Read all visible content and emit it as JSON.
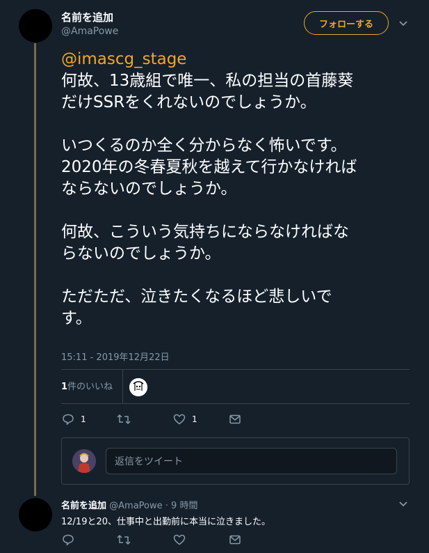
{
  "main_tweet": {
    "author_name": "名前を追加",
    "author_handle": "@AmaPowe",
    "follow_label": "フォローする",
    "mention": "@imascg_stage",
    "lines": [
      "何故、13歳組で唯一、私の担当の首藤葵",
      "だけSSRをくれないのでしょうか。",
      "",
      "いつくるのか全く分からなく怖いです。",
      "2020年の冬春夏秋を越えて行かなければ",
      "ならないのでしょうか。",
      "",
      "何故、こういう気持ちにならなければな",
      "らないのでしょうか。",
      "",
      "ただただ、泣きたくなるほど悲しいで",
      "す。"
    ],
    "timestamp": "15:11 - 2019年12月22日",
    "likes_count": "1",
    "likes_label": "件のいいね",
    "reply_count": "1",
    "retweet_count": "",
    "like_count": "1"
  },
  "reply_composer": {
    "placeholder": "返信をツイート"
  },
  "reply_tweet": {
    "author_name": "名前を追加",
    "author_handle": "@AmaPowe",
    "time": "· 9 時間",
    "text": "12/19と20、仕事中と出勤前に本当に泣きました。"
  },
  "colors": {
    "background": "#15202b",
    "accent": "#f5a623",
    "muted": "#8899a6",
    "border": "#38444d"
  }
}
